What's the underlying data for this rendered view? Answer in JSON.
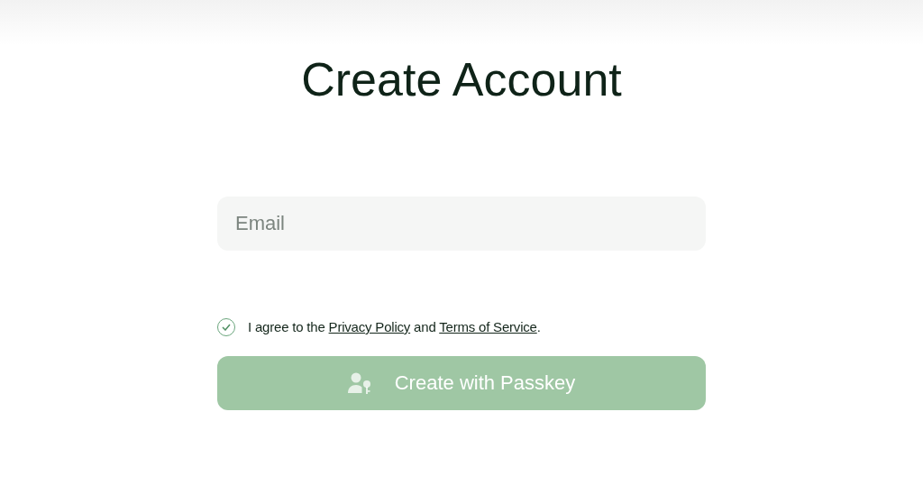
{
  "title": "Create Account",
  "email_field": {
    "placeholder": "Email"
  },
  "agreement": {
    "checked": true,
    "parts": [
      {
        "kind": "text",
        "text": "I agree to the "
      },
      {
        "kind": "link",
        "text": "Privacy Policy"
      },
      {
        "kind": "text",
        "text": " and "
      },
      {
        "kind": "link",
        "text": "Terms of Service"
      },
      {
        "kind": "text",
        "text": "."
      }
    ]
  },
  "create_button": {
    "label": "Create with Passkey",
    "disabled": true
  }
}
